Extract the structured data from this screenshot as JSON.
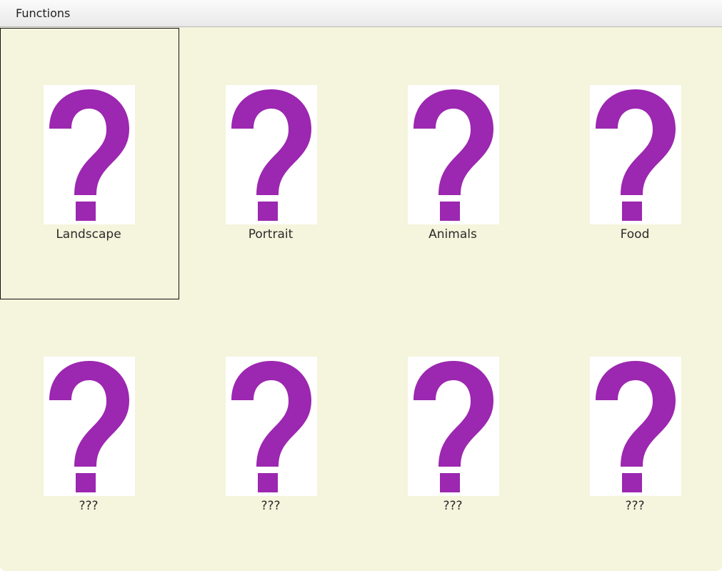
{
  "menubar": {
    "items": [
      {
        "label": "Functions"
      }
    ]
  },
  "colors": {
    "background": "#f5f4dc",
    "icon": "#9c27b0",
    "thumb_background": "#ffffff"
  },
  "tiles": [
    {
      "label": "Landscape",
      "icon": "question-mark-icon",
      "selected": true
    },
    {
      "label": "Portrait",
      "icon": "question-mark-icon",
      "selected": false
    },
    {
      "label": "Animals",
      "icon": "question-mark-icon",
      "selected": false
    },
    {
      "label": "Food",
      "icon": "question-mark-icon",
      "selected": false
    },
    {
      "label": "???",
      "icon": "question-mark-icon",
      "selected": false
    },
    {
      "label": "???",
      "icon": "question-mark-icon",
      "selected": false
    },
    {
      "label": "???",
      "icon": "question-mark-icon",
      "selected": false
    },
    {
      "label": "???",
      "icon": "question-mark-icon",
      "selected": false
    }
  ]
}
